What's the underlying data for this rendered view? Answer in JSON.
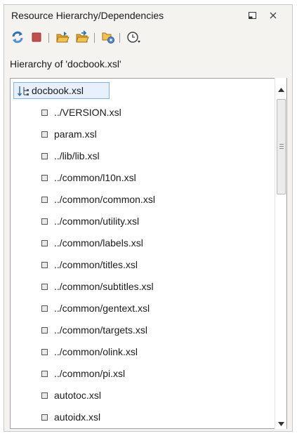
{
  "panel": {
    "title": "Resource Hierarchy/Dependencies",
    "restore_icon": "restore-window-icon",
    "close_icon": "close-icon"
  },
  "toolbar": {
    "buttons": [
      {
        "name": "refresh",
        "icon": "refresh-arrows-icon"
      },
      {
        "name": "stop",
        "icon": "stop-square-icon"
      },
      {
        "name": "show-hierarchy",
        "icon": "folder-open-icon"
      },
      {
        "name": "show-dependencies",
        "icon": "folder-arrow-icon"
      },
      {
        "name": "configure",
        "icon": "folder-gear-icon"
      },
      {
        "name": "history",
        "icon": "clock-dropdown-icon"
      }
    ]
  },
  "hierarchy_label": "Hierarchy of 'docbook.xsl'",
  "tree": {
    "root": "docbook.xsl",
    "items": [
      "../VERSION.xsl",
      "param.xsl",
      "../lib/lib.xsl",
      "../common/l10n.xsl",
      "../common/common.xsl",
      "../common/utility.xsl",
      "../common/labels.xsl",
      "../common/titles.xsl",
      "../common/subtitles.xsl",
      "../common/gentext.xsl",
      "../common/targets.xsl",
      "../common/olink.xsl",
      "../common/pi.xsl",
      "autotoc.xsl",
      "autoidx.xsl"
    ]
  },
  "colors": {
    "selection_border": "#7eb4ea",
    "selection_fill": "#e8f1fb",
    "refresh_blue": "#2f6fb3",
    "stop_red": "#c0504d",
    "folder_yellow": "#f2c14e"
  }
}
